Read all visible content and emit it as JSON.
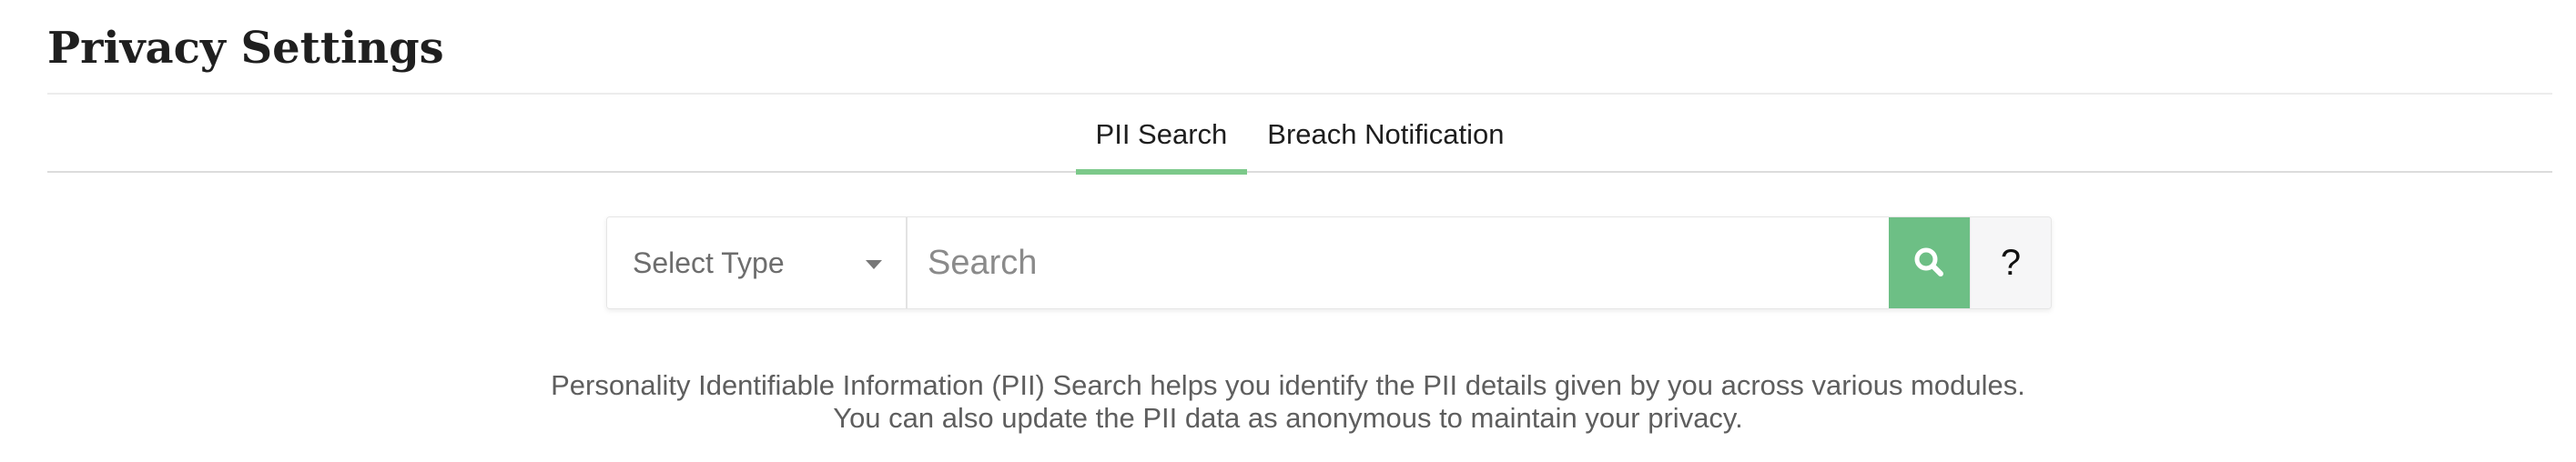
{
  "page": {
    "title": "Privacy Settings"
  },
  "tabs": [
    {
      "label": "PII Search",
      "active": true
    },
    {
      "label": "Breach Notification",
      "active": false
    }
  ],
  "search": {
    "select_value": "Select Type",
    "placeholder": "Search",
    "value": "",
    "search_icon": "search-icon",
    "help_label": "?"
  },
  "description": {
    "line1": "Personality Identifiable Information (PII) Search helps you identify the PII details given by you across various modules.",
    "line2": "You can also update the PII data as anonymous to maintain your privacy."
  },
  "colors": {
    "accent": "#6dbf85",
    "tab_underline": "#7cc98a",
    "help_bg": "#f6f6f7"
  }
}
